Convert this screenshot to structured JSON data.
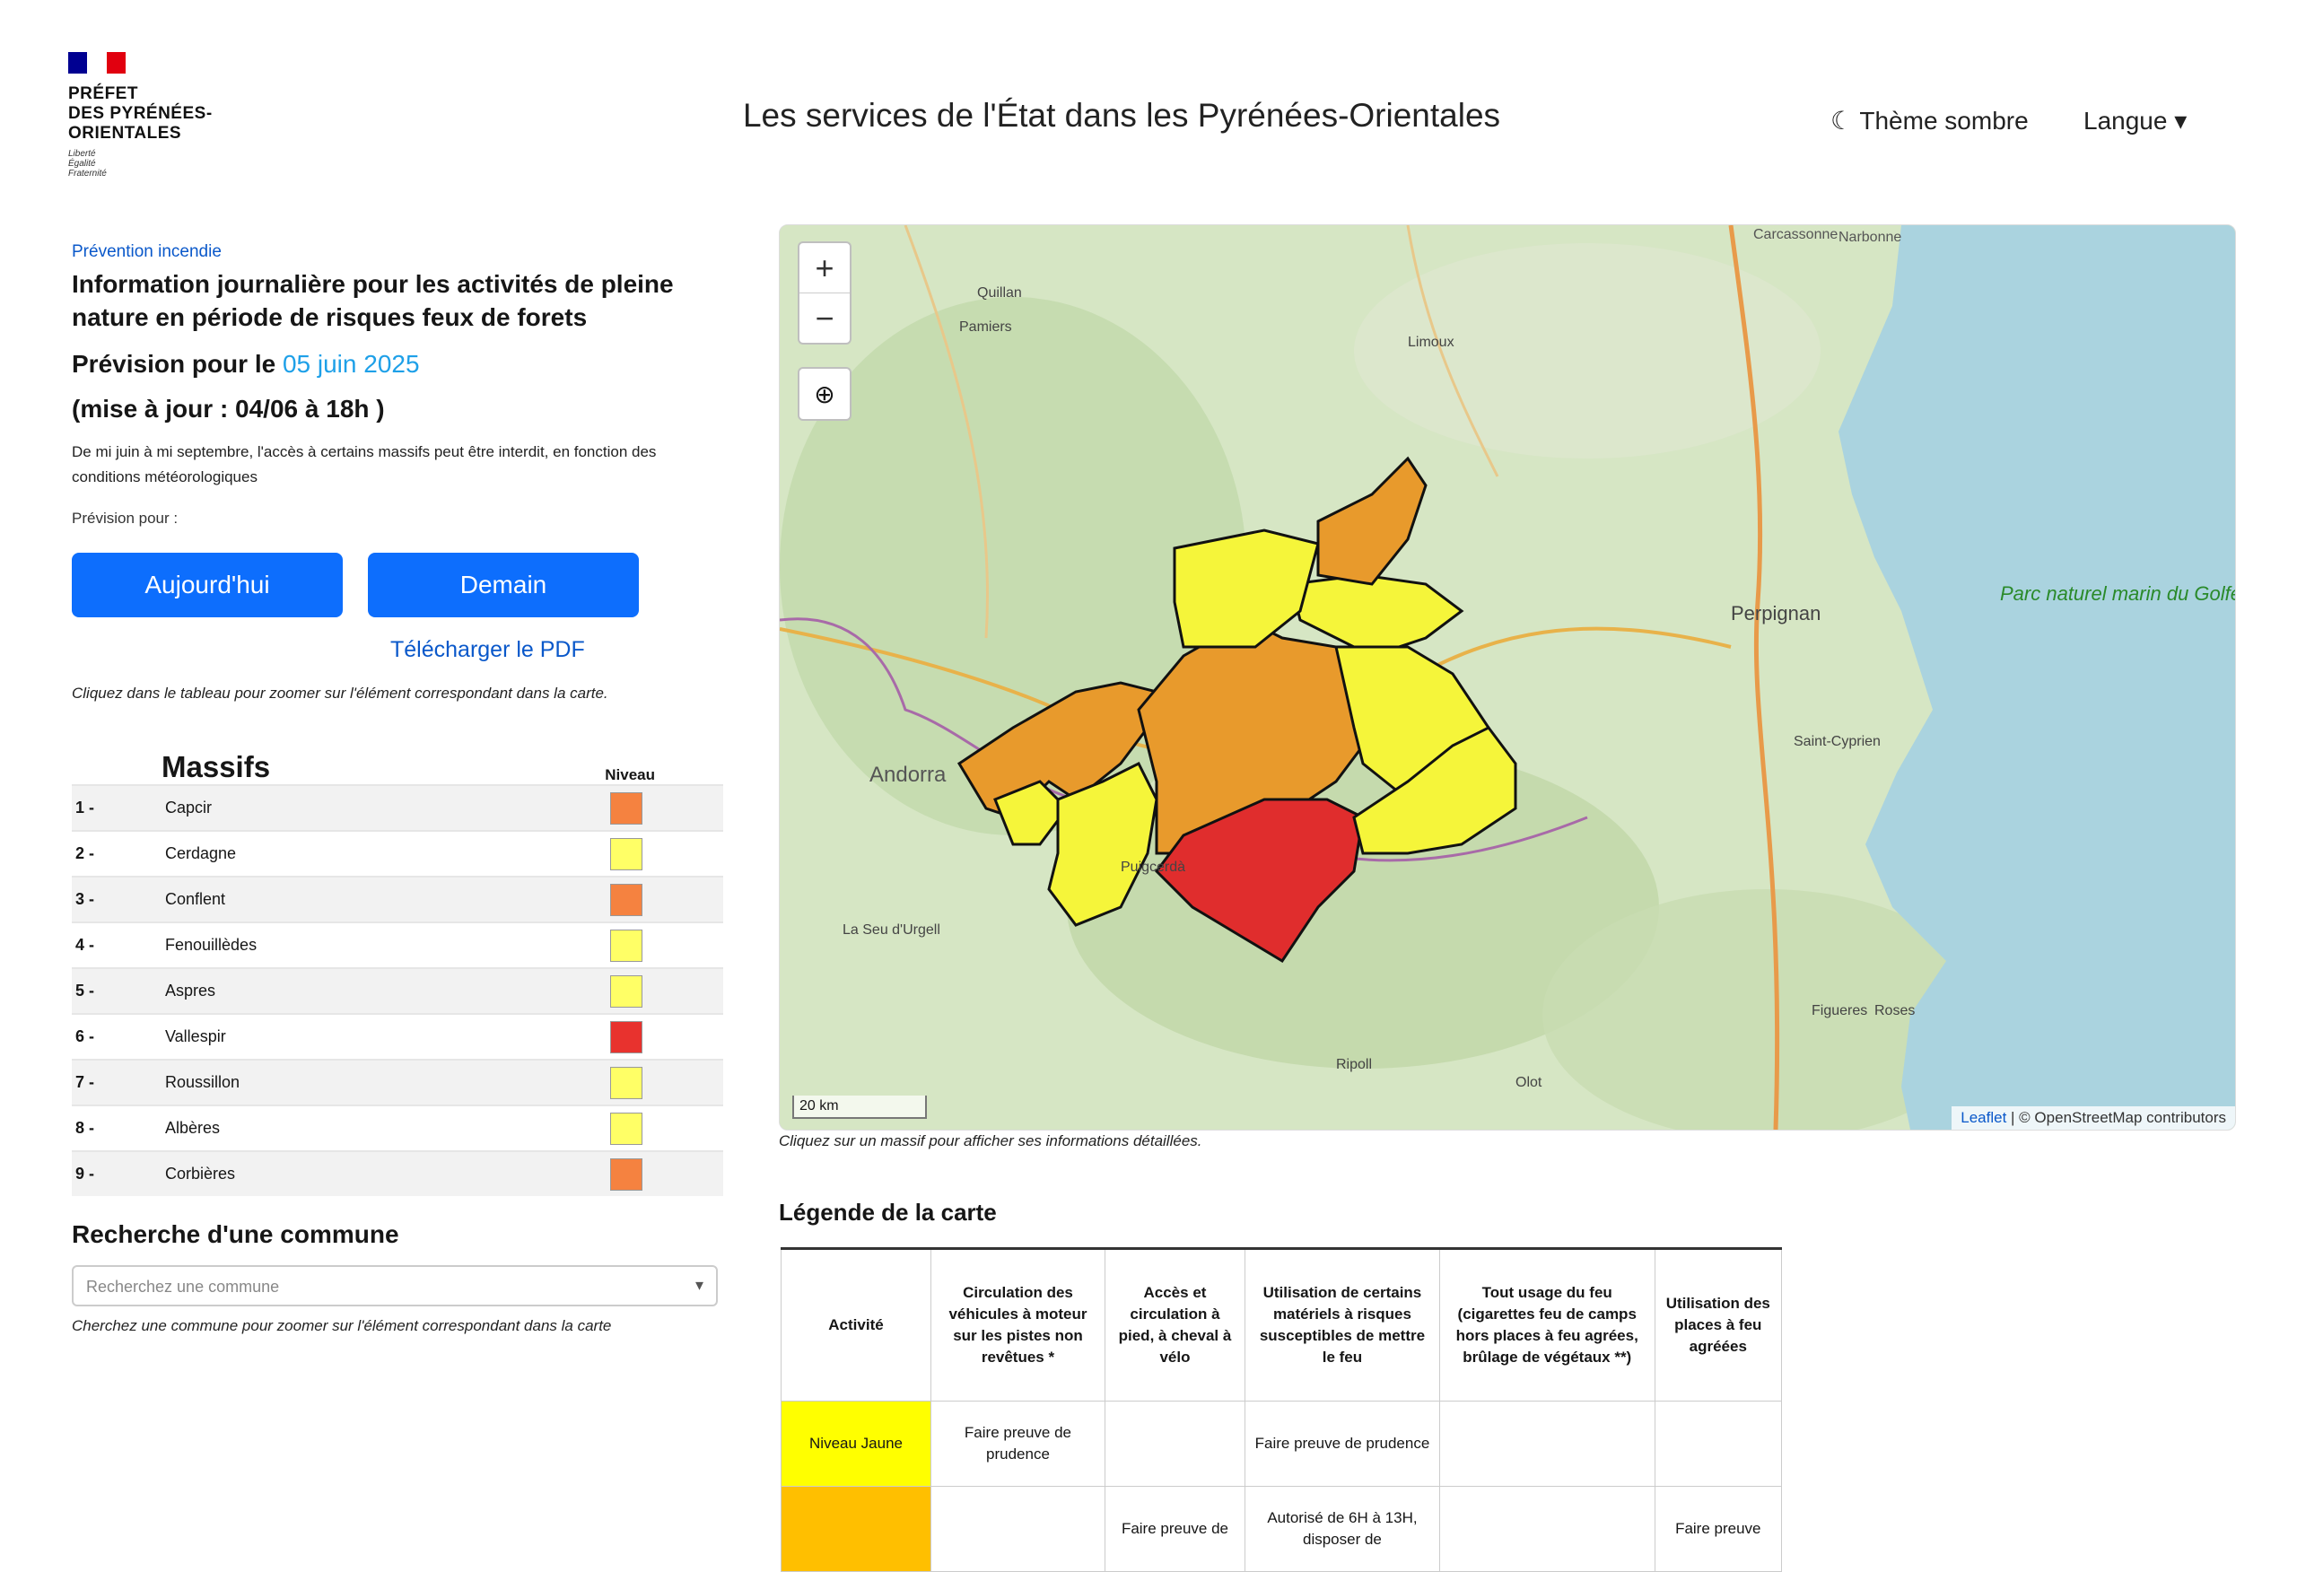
{
  "header": {
    "logo_lines": [
      "PRÉFET",
      "DES PYRÉNÉES-",
      "ORIENTALES"
    ],
    "logo_devise": [
      "Liberté",
      "Égalité",
      "Fraternité"
    ],
    "title": "Les services de l'État dans les Pyrénées-Orientales",
    "theme_label": "☾ Thème sombre",
    "lang_label": "Langue ▾"
  },
  "left": {
    "kicker": "Prévention incendie",
    "lead": "Information journalière pour les activités de pleine nature en période de risques feux de forets",
    "forecast_prefix": "Prévision pour le ",
    "forecast_date": "05 juin 2025",
    "update": "(mise à jour : 04/06 à 18h )",
    "note": "De mi juin à mi septembre, l'accès à certains massifs peut être interdit, en fonction des conditions météorologiques",
    "prev_label": "Prévision pour :",
    "btn_today": "Aujourd'hui",
    "btn_tomorrow": "Demain",
    "pdf_link": "Télécharger le PDF",
    "table_hint": "Cliquez dans le tableau pour zoomer sur l'élément correspondant dans la carte."
  },
  "massifs": {
    "title": "Massifs",
    "level_header": "Niveau",
    "rows": [
      {
        "num": "1 -",
        "name": "Capcir",
        "color": "#f58240"
      },
      {
        "num": "2 -",
        "name": "Cerdagne",
        "color": "#ffff66"
      },
      {
        "num": "3 -",
        "name": "Conflent",
        "color": "#f58240"
      },
      {
        "num": "4 -",
        "name": "Fenouillèdes",
        "color": "#ffff66"
      },
      {
        "num": "5 -",
        "name": "Aspres",
        "color": "#ffff66"
      },
      {
        "num": "6 -",
        "name": "Vallespir",
        "color": "#e8322e"
      },
      {
        "num": "7 -",
        "name": "Roussillon",
        "color": "#ffff66"
      },
      {
        "num": "8 -",
        "name": "Albères",
        "color": "#ffff66"
      },
      {
        "num": "9 -",
        "name": "Corbières",
        "color": "#f58240"
      }
    ]
  },
  "search": {
    "title": "Recherche d'une commune",
    "placeholder": "Recherchez une commune",
    "hint": "Cherchez une commune pour zoomer sur l'élément correspondant dans la carte"
  },
  "map": {
    "zoom_in": "+",
    "zoom_out": "−",
    "scale": "20 km",
    "attribution_leaflet": "Leaflet",
    "attribution_osm": "| © OpenStreetMap contributors",
    "hint": "Cliquez sur un massif pour afficher ses informations détaillées.",
    "places": [
      {
        "name": "Carcassonne"
      },
      {
        "name": "Narbonne"
      },
      {
        "name": "Perpignan"
      },
      {
        "name": "Andorra"
      },
      {
        "name": "Saint-Cyprien"
      },
      {
        "name": "Roses"
      },
      {
        "name": "Figueres"
      },
      {
        "name": "Olot"
      },
      {
        "name": "Ripoll"
      },
      {
        "name": "Limoux"
      },
      {
        "name": "Quillan"
      },
      {
        "name": "Puigcerdà"
      },
      {
        "name": "La Seu d'Urgell"
      },
      {
        "name": "Pamiers"
      }
    ],
    "sea_label": "Parc naturel marin du Golfe du Lion",
    "colors": {
      "yellow": "#f5f53a",
      "orange": "#e89a2c",
      "red": "#e02d2d"
    }
  },
  "legend": {
    "title": "Légende de la carte",
    "headers": [
      "Activité",
      "Circulation des véhicules à moteur sur les pistes non revêtues *",
      "Accès et circulation à pied, à cheval à vélo",
      "Utilisation de certains matériels à risques susceptibles de mettre le feu",
      "Tout usage du feu (cigarettes feu de camps hors places à feu agrées, brûlage de végétaux **)",
      "Utilisation des places à feu agréées"
    ],
    "row1_level": "Niveau Jaune",
    "row1_c1": "Faire preuve de prudence",
    "row1_c3": "Faire preuve de prudence",
    "row2_c2": "Faire preuve de",
    "row2_c3": "Autorisé de 6H à 13H, disposer de",
    "row2_c5": "Faire preuve"
  }
}
